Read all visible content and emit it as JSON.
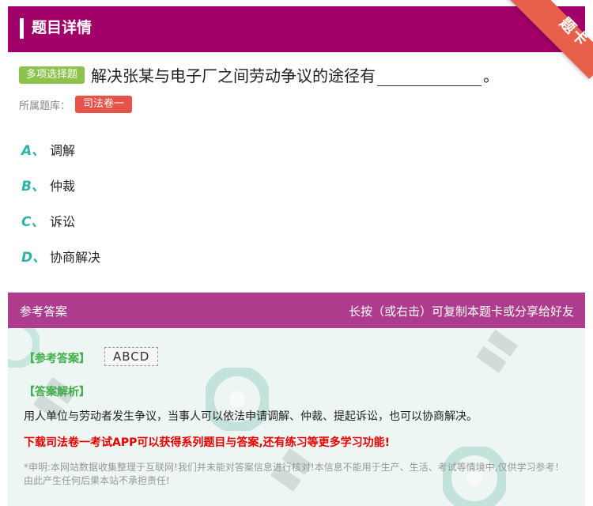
{
  "header": {
    "title": "题目详情"
  },
  "ribbon": {
    "label": "题卡"
  },
  "question": {
    "type": "多项选择题",
    "text_before": "解决张某与电子厂之间劳动争议的途径有",
    "text_after": "。",
    "bank_label": "所属题库：",
    "bank": "司法卷一"
  },
  "options": [
    {
      "letter": "A、",
      "text": "调解"
    },
    {
      "letter": "B、",
      "text": "仲裁"
    },
    {
      "letter": "C、",
      "text": "诉讼"
    },
    {
      "letter": "D、",
      "text": "协商解决"
    }
  ],
  "answer_header": {
    "left": "参考答案",
    "right": "长按（或右击）可复制本题卡或分享给好友"
  },
  "answer": {
    "label": "【参考答案】",
    "value": "ABCD",
    "analysis_label": "【答案解析】",
    "analysis": "用人单位与劳动者发生争议，当事人可以依法申请调解、仲裁、提起诉讼，也可以协商解决。",
    "promo": "下载司法卷一考试APP可以获得系列题目与答案,还有练习等更多学习功能!",
    "disclaimer": "*申明:本网站数据收集整理于互联网!我们并未能对答案信息进行核对!本信息不能用于生产、生活、考试等情境中,仅供学习参考！由此产生任何后果本站不承担责任!"
  },
  "colors": {
    "header_bg": "#a10068",
    "answer_header_bg": "#ad3c8c",
    "answer_body_bg": "#edf6f2",
    "type_tag": "#8cc34a",
    "bank_tag": "#e5534b",
    "option_letter": "#2bb3a8",
    "label_green": "#3fae49",
    "promo_red": "#e60000"
  }
}
